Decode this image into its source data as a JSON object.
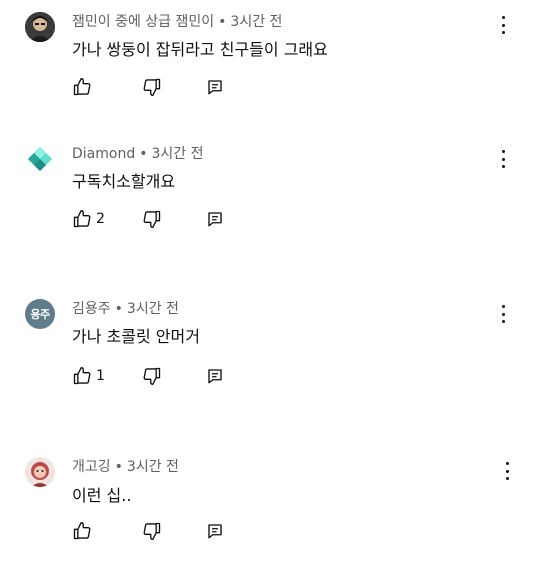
{
  "comments": [
    {
      "author": "잼민이 중에 상급 잼민이",
      "time": "3시간 전",
      "text": "가나 쌍둥이 잡뒤라고 친구들이 그래요",
      "likes": "",
      "avatar": {
        "type": "photo",
        "color": "#2b2b2b"
      }
    },
    {
      "author": "Diamond",
      "time": "3시간 전",
      "text": "구독치소할개요",
      "likes": "2",
      "avatar": {
        "type": "diamond",
        "color": "#4fd1c5"
      }
    },
    {
      "author": "김용주",
      "time": "3시간 전",
      "text": "가나 초콜릿 안머거",
      "likes": "1",
      "avatar": {
        "type": "initials",
        "initials": "용주",
        "color": "#5f7c8a"
      }
    },
    {
      "author": "개고깅",
      "time": "3시간 전",
      "text": "이런 십..",
      "likes": "",
      "avatar": {
        "type": "photo",
        "color": "#c0504d"
      }
    }
  ],
  "separator": "•",
  "icons": {
    "like": "thumbs-up-icon",
    "dislike": "thumbs-down-icon",
    "reply": "reply-icon",
    "more": "more-vertical-icon"
  }
}
